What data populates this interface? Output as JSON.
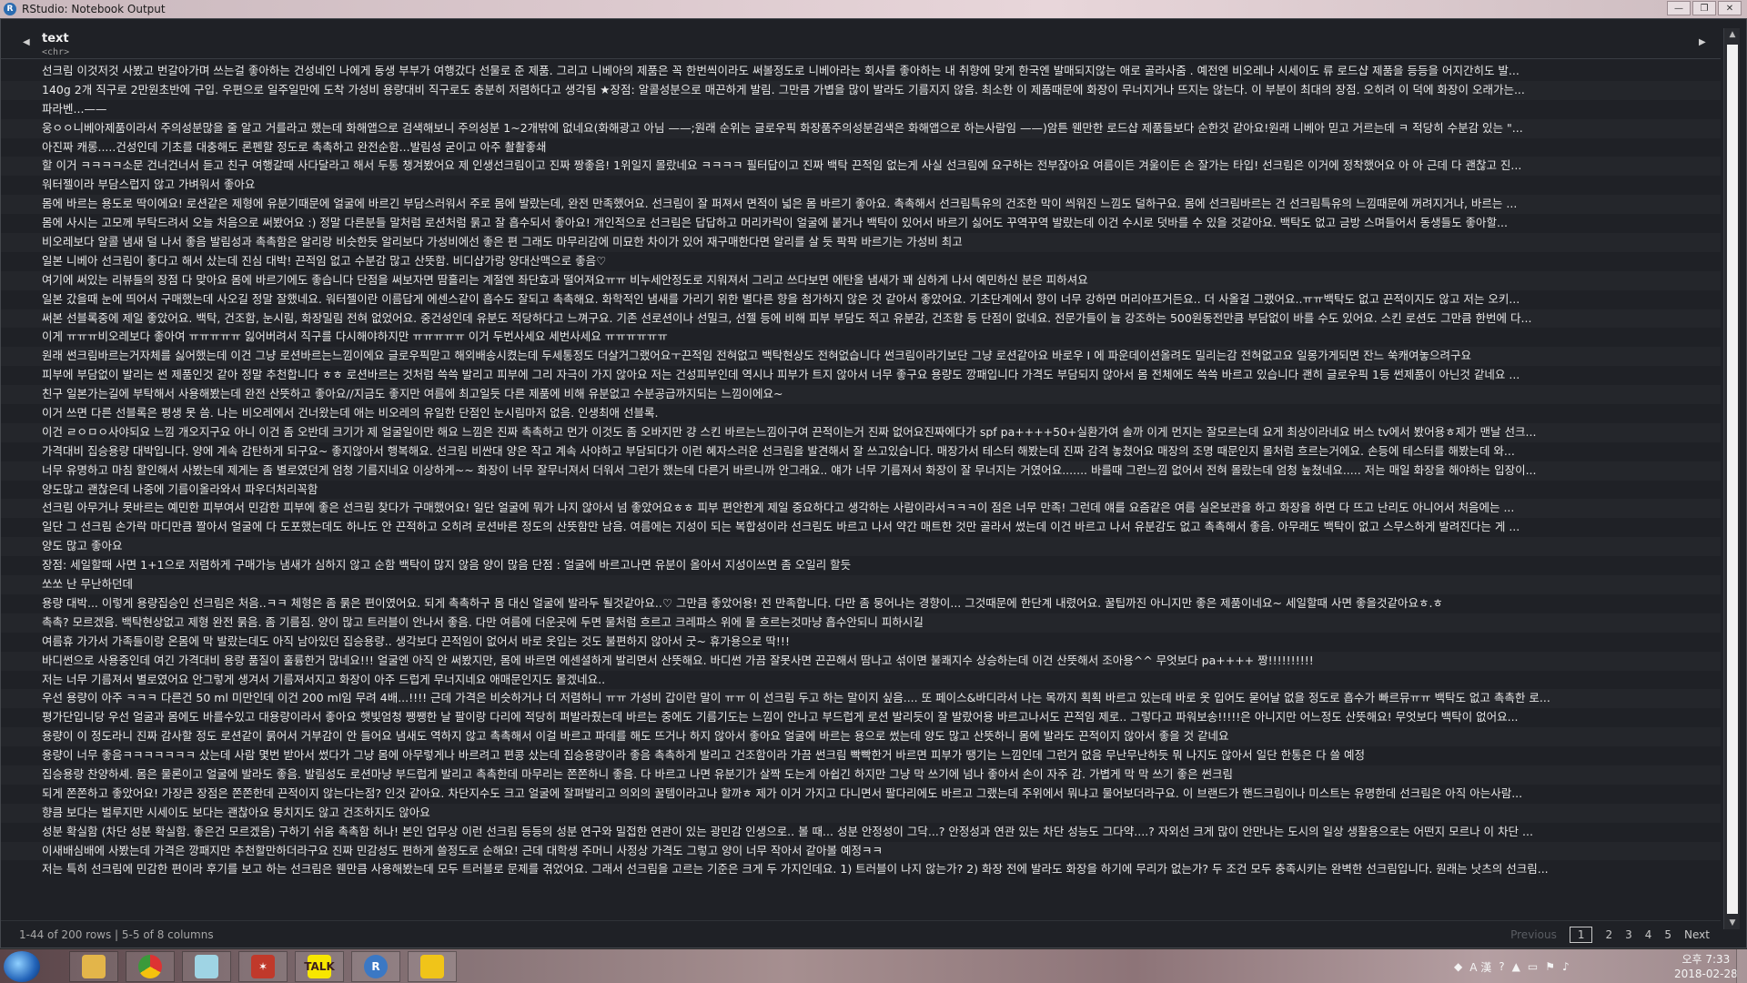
{
  "window": {
    "title": "RStudio: Notebook Output",
    "controls": {
      "minimize": "—",
      "maximize": "❐",
      "close": "✕"
    }
  },
  "table": {
    "column": {
      "name": "text",
      "type": "<chr>"
    },
    "nav_left": "◀",
    "nav_right": "▶",
    "rows": [
      "선크림 이것저것 사봤고 번갈아가며 쓰는걸 좋아하는 건성네인 나에게 동생 부부가 여행갔다 선물로 준 제품. 그리고 니베아의 제품은 꼭 한번씩이라도 써볼정도로 니베아라는 회사를 좋아하는 내 취향에 맞게 한국엔 발매되지않는 애로 골라사줌 . 예전엔 비오레나 시세이도 류 로드샵 제품을 등등을 어지간히도 발...",
      "140g 2개 직구로 2만원초반에 구입. 우편으로 일주일만에 도착 가성비 용량대비 직구로도 충분히 저렴하다고 생각됨 ★장점: 알콜성분으로 매끈하게 발림. 그만큼 가볍을 많이 발라도 기름지지 않음. 최소한 이 제품때문에 화장이 무너지거나 뜨지는 않는다. 이 부분이 최대의 장점. 오히려 이 덕에 화장이 오래가는...",
      "파라벤...——",
      "웅ㅇㅇ니베아제품이라서 주의성분많을 줄 알고 거를라고 했는데 화해앱으로 검색해보니 주의성분 1~2개밖에 없네요(화해광고 아님 ——;원래 순위는 글로우픽 화장품주의성분검색은 화해앱으로 하는사람임 ——)암튼 웬만한 로드샵 제품들보다 순한것 같아요!원래 니베아 믿고 거르는데 ㅋ 적당히 수분감 있는 \"...",
      "아진짜 캐롱.....건성인데 기초를 대충해도 론펜할 정도로 촉촉하고 완전순함...발림성 굳이고 아주 촬촬좋쇄",
      "할 이거 ㅋㅋㅋㅋ소문 건너건너서 듣고 친구 여행갈때 사다달라고 해서 두통 챙겨봤어요 제 인생선크림이고 진짜 짱좋음! 1위일지 몰랐네요 ㅋㅋㅋㅋ 필터답이고 진짜 백탁 끈적임 없는게 사실 선크림에 요구하는 전부잖아요 여름이든 겨울이든 손 잘가는 타입! 선크림은 이거에 정착했어요 아 아 근데 다 괜찮고 진...",
      "워터젤이라 부담스럽지 않고 가벼워서 좋아요",
      "몸에 바르는 용도로 딱이에요! 로션같은 제형에 유분기때문에 얼굴에 바르긴 부담스러워서 주로 몸에 발랐는데, 완전 만족했어요. 선크림이 잘 퍼져서 면적이 넓은 몸 바르기 좋아요. 촉촉해서 선크림특유의 건조한 막이 씌워진 느낌도 덜하구요. 몸에 선크림바르는 건 선크림특유의 느낌때문에 꺼려지거나, 바르는 ...",
      "몸에 사시는 고모께 부탁드려서 오늘 처음으로 써봤어요 :) 정말 다른분들 말처럼 로션처럼 묽고 잘 흡수되서 좋아요! 개인적으로 선크림은 답답하고 머리카락이 얼굴에 붙거나 백탁이 있어서 바르기 싫어도 꾸역꾸역 발랐는데 이건 수시로 덧바를 수 있을 것같아요. 백탁도 없고 금방 스며들어서 동생들도 좋아할...",
      "비오레보다 알콜 냄새 덜 나서 좋음 발림성과 촉촉함은 알리랑 비슷한듯 알리보다 가성비에선 좋은 편 그래도 마무리감에 미묘한 차이가 있어 재구매한다면 알리를 살 듯 팍팍 바르기는 가성비 최고",
      "일본 니베아 선크림이 좋다고 해서 샀는데 진심 대박! 끈적임 없고 수분감 많고 산뜻함. 비디샵가랑 양대산맥으로 좋음♡",
      "여기에 써있는 리뷰들의 장점 다 맞아요 몸에 바르기에도 좋습니다 단점을 써보자면 땀흘리는 계절엔 좌단효과 떨어져요ㅠㅠ 비누세안정도로 지워져서 그리고 쓰다보면 에탄올 냄새가 꽤 심하게 나서 예민하신 분은 피하셔요",
      "일본 갔을때 눈에 띄어서 구매했는데 사오길 정말 잘했네요. 워터젤이란 이름답게 에센스같이 흡수도 잘되고 촉촉해요. 화학적인 냄새를 가리기 위한 별다른 향을 첨가하지 않은 것 같아서 좋았어요. 기초단계에서 향이 너무 강하면 머리아프거든요.. 더 사올걸 그랬어요..ㅠㅠ백탁도 없고 끈적이지도 않고 저는 오키...",
      "써본 선블록중에 제일 좋았어요. 백탁, 건조함, 눈시림, 화장밀림 전혀 없었어요. 중건성인데 유분도 적당하다고 느껴구요. 기존 선로션이나 선밀크, 선젤 등에 비해 피부 부담도 적고 유분감, 건조함 등 단점이 없네요. 전문가들이 늘 강조하는 500원동전만큼 부담없이 바를 수도 있어요. 스킨 로션도 그만큼 한번에 다...",
      "이게 ㅠㅠㅠ비오레보다 좋아여 ㅠㅠㅠㅠㅠ 잃어버려서 직구를 다시해야하지만 ㅠㅠㅠㅠㅠ 이거 두번사세요 세번사세요 ㅠㅠㅠㅠㅠㅠ",
      "원래 썬크림바르는거자체를 싫어했는데 이건 그냥 로션바르는느낌이에요 글로우픽맏고 해외배송시켰는데 두세통정도 더살거그랬어요ㅜ끈적임 전혀없고 백탁현상도 전혀없습니다 썬크림이라기보단 그냥 로션같아요 바로우 I 에 파운데이션올려도 밀리는감 전혀없고요 일몽가게되면 잔느 쑥캐여놓으려구요",
      "피부에 부담없이 발리는 썬 제품인것 같아 정말 추천합니다 ㅎㅎ 로션바르는 것처럼 쓱쓱 발리고 피부에 그리 자극이 가지 않아요 저는 건성피부인데 역시나 피부가 트지 않아서 너무 좋구요 용량도 깡패입니다 가격도 부담되지 않아서 몸 전체에도 쓱쓱 바르고 있습니다 괜히 글로우픽 1등 썬제품이 아닌것 같네요 ...",
      "친구 일본가는길에 부탁해서 사용해봤는데 완전 산뜻하고 좋아요//지금도 좋지만 여름에 최고일듯 다른 제품에 비해 유분없고 수분공급까지되는 느낌이에요~",
      "이거 쓰면 다른 선블록은 평생 못 씀. 나는 비오레에서 건너왔는데 애는 비오레의 유일한 단점인 눈시림마저 없음. 인생최애 선블록.",
      "이건 ㄹㅇㅁㅇ사야되요 느낌 개오지구요 아니 이건 좀 오반데 크기가 제 얼굴일이만 해요 느낌은 진짜 촉촉하고 먼가 이것도 좀 오바지만 걍 스킨 바르는느낌이구여 끈적이는거 진짜 없어요진짜에다가 spf pa++++50+실환가여 솔까 이게 먼지는 잘모르는데 요게 최상이라네요 버스 tv에서 봤어용ㅎ제가 맨날 선크...",
      "가격대비 집승용량 대박입니다. 양에 계속 감탄하게 되구요~ 좋지않아서 행복해요. 선크림 비싼대 양은 작고 계속 사야하고 부담되다가 이런 혜자스러운 선크림을 발견해서 잘 쓰고있습니다. 매장가서 테스터 해봤는데 진짜 감격 놓쳤어요 매장의 조명 때문인지 몰처럼 흐르는거에요. 손등에 테스터를 해봤는데 와...",
      "너무 유명하고 마침 할인해서 사봤는데 제게는 좀 별로였던게 엄청 기름지네요 이상하게~~ 화장이 너무 잘무너져서 더워서 그런가 했는데 다른거 바르니까 안그래요.. 얘가 너무 기름져서 화장이 잘 무너지는 거였어요....... 바를때 그런느낌 없어서 전혀 몰랐는데 엄청 높쳤네요..... 저는 매일 화장을 해야하는 입장이...",
      "양도많고 괜찮은데 나중에 기름이올라와서 파우더처리꼭함",
      "선크림 아무거나 못바르는 예민한 피부여서 민감한 피부에 좋은 선크림 찾다가 구매했어요! 일단 얼굴에 뭐가 나지 않아서 넘 좋았어요ㅎㅎ 피부 편안한게 제일 중요하다고 생각하는 사람이라서ㅋㅋㅋ이 점은 너무 만족! 그런데 얘를 요즘같은 여름 실온보관을 하고 화장을 하면 다 뜨고 난리도 아니어서 처음에는 ...",
      "일단 그 선크림 손가락 마디만큼 짤아서 얼굴에 다 도포했는데도 하나도 안 끈적하고 오히려 로션바른 정도의 산뜻함만 남음. 여름에는 지성이 되는 복합성이라 선크림도 바르고 나서 약간 매트한 것만 골라서 썼는데 이건 바르고 나서 유분감도 없고 촉촉해서 좋음. 아무래도 백탁이 없고 스무스하게 발려진다는 게 ...",
      "양도 많고 좋아요",
      "장점: 세일할때 사면 1+1으로 저렴하게 구매가능 냄새가 심하지 않고 순함 백탁이 많지 않음 양이 많음 단점 : 얼굴에 바르고나면 유분이 올아서 지성이쓰면 좀 오일리 할듯",
      "쏘쏘 난 무난하던데",
      "용량 대박... 이렇게 용량집승인 선크림은 처음..ㅋㅋ 체형은 좀 묽은 편이였어요. 되게 촉촉하구 몸 대신 얼굴에 발라두 될것같아요..♡ 그만큼 좋았어용! 전 만족합니다. 다만 좀 뭉어나는 경향이... 그것때문에 한단계 내렸어요. 꿀팁까진 아니지만 좋은 제품이네요~ 세일할때 사면 좋을것같아요ㅎ.ㅎ",
      "촉촉? 모르겠음. 백탁현상없고 제형 완전 묽음. 좀 기름짐. 양이 많고 트러블이 안나서 좋음. 다만 여름에 더운곳에 두면 물처럼 흐르고 크레파스 위에 물 흐르는것마냥 흡수안되니 피하시길",
      "여름휴 가가서 가족들이랑 온몸에 막 발랐는데도 아직 남아있던 집승용량.. 생각보다 끈적임이 없어서 바로 옷입는 것도 불편하지 않아서 굿~ 휴가용으로 딱!!!",
      "바디썬으로 사용중인데 여긴 가격대비 용량 품질이 훌륭한거 많네요!!! 얼굴엔 아직 안 써봤지만, 몸에 바르면 에센셜하게 발리면서 산뜻해요. 바디썬 가끔 잘못사면 끈끈해서 땀나고 섞이면 불쾌지수 상승하는데 이건 산뜻해서 조아용^^ 무엇보다 pa++++ 짱!!!!!!!!!!",
      "저는 너무 기름져서 별로였어요 안그렇게 생겨서 기름져서지고 화장이 아주 드럽게 무너지네요 애매문인지도 몰겠네요..",
      "우선 용량이 아주 ㅋㅋㅋ 다른건 50 ml 미만인데 이건 200 ml임 무려 4배...!!!! 근데 가격은 비슷하거나 더 저렴하니 ㅠㅠ 가성비 갑이란 말이 ㅠㅠ 이 선크림 두고 하는 말이지 싶음.... 또 페이스&바디라서 나는 목까지 획획 바르고 있는데 바로 옷 입어도 묻어날 없을 정도로 흡수가 빠르뮤ㅠㅠ 백탁도 없고 촉촉한 로...",
      "평가단입니당 우선 얼굴과 몸에도 바를수있고 대용량이라서 좋아요 햇빛엄청 쨍쨍한 날 팔이랑 다리에 적당히 펴발라줬는데 바르는 중에도 기름기도는 느낌이 안나고 부드럽게 로션 발리듯이 잘 발랐어용 바르고나서도 끈적임 제로.. 그렇다고 파워보송!!!!!은 아니지만 어느정도 산뜻해요! 무엇보다 백탁이 없어요...",
      "용량이 이 정도라니 진짜 감사할 정도 로션같이 묽어서 거부감이 안 들어요 냄새도 역하지 않고 촉촉해서 이걸 바르고 파데를 해도 뜨거나 하지 않아서 좋아요 얼굴에 바르는 용으로 썼는데 양도 많고 산뜻하니 몸에 발라도 끈적이지 않아서 좋을 것 같네요",
      "용량이 너무 좋음ㅋㅋㅋㅋㅋㅋㅋ 샀는데 사람 몇번 받아서 썼다가 그냥 몸에 아무렇게나 바르려고 편콩 샀는데 집승용량이라 좋음 촉촉하게 발리고 건조함이라 가끔 썬크림 빡빡한거 바르면 피부가 땡기는 느낌인데 그런거 없음 무난무난하듯 뭐 나지도 않아서 일단 한통은 다 쓸 예정",
      "집승용량 찬양하셰. 몸은 물론이고 얼굴에 발라도 좋음. 발림성도 로션마냥 부드럽게 발리고 촉촉한데 마무리는 쫀쫀하니 좋음. 다 바르고 나면 유분기가 살짝 도는게 아쉽긴 하지만 그냥 막 쓰기에 넘나 좋아서 손이 자주 감. 가볍게 막 막 쓰기 좋은 썬크림",
      "되게 쫀쫀하고 좋았어요! 가장큰 장점은 쫀쫀한데 끈적이지 않는다는점? 인것 같아요. 차단지수도 크고 얼굴에 잘펴발리고 의외의 꿀템이라고나 할까ㅎ 제가 이거 가지고 다니면서 팔다리에도 바르고 그랬는데 주위에서 뭐냐고 물어보더라구요. 이 브랜드가 핸드크림이나 미스트는 유명한데 선크림은 아직 아는사람...",
      "향큼 보다는 벌루지만 시세이도 보다는 괜찮아요 뭉치지도 않고 건조하지도 않아요",
      "성분 확실함 (차단 성분 확실함. 좋은건 모르겠음) 구하기 쉬움 촉촉함 허나! 본인 업무상 이런 선크림 등등의 성분 연구와 밀접한 연관이 있는 광민감 인생으로.. 볼 때... 성분 안정성이 그닥...? 안정성과 연관 있는 차단 성능도 그다약....? 자외선 크게 많이 안만나는 도시의 일상 생활용으로는 어떤지 모르나 이 차단 ...",
      "이새배심배에 사봤는데 가격은 깡패지만 추천할만하더라구요 진짜 민감성도 편하게 쓸정도로 순해요! 근데 대학생 주머니 사정상 가격도 그렇고 양이 너무 작아서 같아볼 예정ㅋㅋ",
      "저는 특히 선크림에 민감한 편이라 후기를 보고 하는 선크림은 웬만큼 사용해봤는데 모두 트러블로 문제를 겪었어요. 그래서 선크림을 고르는 기준은 크게 두 가지인데요. 1) 트러블이 나지 않는가? 2) 화장 전에 발라도 화장을 하기에 무리가 없는가? 두 조건 모두 충족시키는 완벽한 선크림입니다. 원래는 낫츠의 선크림..."
    ]
  },
  "footer": {
    "info": "1-44 of 200 rows | 5-5 of 8 columns",
    "pager": {
      "previous": "Previous",
      "pages": [
        "1",
        "2",
        "3",
        "4",
        "5"
      ],
      "current": "1",
      "next": "Next"
    }
  },
  "taskbar": {
    "apps": [
      "windows-explorer",
      "chrome",
      "notepad",
      "game-app",
      "kakaotalk",
      "rstudio",
      "security-app"
    ],
    "kakao_label": "TALK",
    "rstudio_label": "R",
    "tray_text": "A 漢",
    "clock_time": "오후 7:33",
    "clock_date": "2018-02-28"
  }
}
